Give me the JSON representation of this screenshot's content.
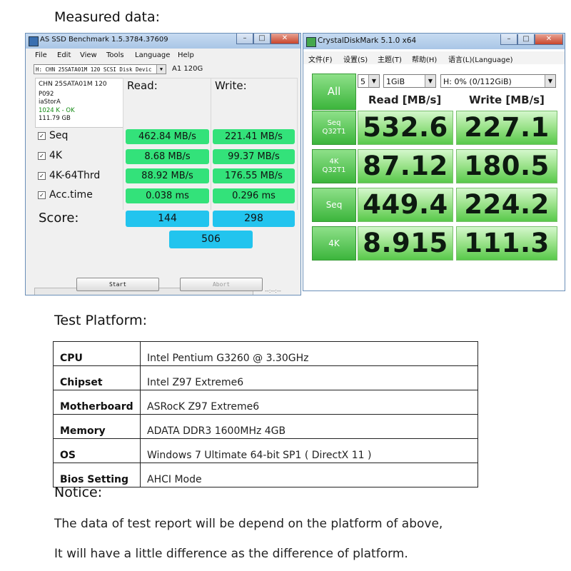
{
  "headings": {
    "measured": "Measured data:",
    "platform": "Test Platform:",
    "notice": "Notice:"
  },
  "asssd": {
    "title": "AS SSD Benchmark 1.5.3784.37609",
    "menu": [
      "File",
      "Edit",
      "View",
      "Tools",
      "Language",
      "Help"
    ],
    "drive_select": "H: CHN 25SATA01M 120 SCSI Disk Devic",
    "drive_name": "A1 120G",
    "info": [
      "CHN 25SATA01M 120",
      "P092",
      "iaStorA",
      "1024 K - OK",
      "111.79 GB"
    ],
    "read_header": "Read:",
    "write_header": "Write:",
    "rows": [
      {
        "label": "Seq",
        "read": "462.84 MB/s",
        "write": "221.41 MB/s"
      },
      {
        "label": "4K",
        "read": "8.68 MB/s",
        "write": "99.37 MB/s"
      },
      {
        "label": "4K-64Thrd",
        "read": "88.92 MB/s",
        "write": "176.55 MB/s"
      },
      {
        "label": "Acc.time",
        "read": "0.038 ms",
        "write": "0.296 ms"
      }
    ],
    "score_label": "Score:",
    "score_read": "144",
    "score_write": "298",
    "score_total": "506",
    "timer": "--:--:--",
    "start": "Start",
    "abort": "Abort",
    "progress_done": 1.0,
    "colors": {
      "green_cell": "#33e27a",
      "blue_cell": "#22c4ee"
    }
  },
  "cdm": {
    "title": "CrystalDiskMark 5.1.0 x64",
    "menu": [
      "文件(F)",
      "设置(S)",
      "主题(T)",
      "帮助(H)",
      "语言(L)(Language)"
    ],
    "all_button": "All",
    "count": "5",
    "size": "1GiB",
    "drive": "H: 0% (0/112GiB)",
    "read_header": "Read [MB/s]",
    "write_header": "Write [MB/s]",
    "rows": [
      {
        "label1": "Seq",
        "label2": "Q32T1",
        "read": "532.6",
        "write": "227.1"
      },
      {
        "label1": "4K",
        "label2": "Q32T1",
        "read": "87.12",
        "write": "180.5"
      },
      {
        "label1": "Seq",
        "label2": "",
        "read": "449.4",
        "write": "224.2"
      },
      {
        "label1": "4K",
        "label2": "",
        "read": "8.915",
        "write": "111.3"
      }
    ]
  },
  "platform": [
    {
      "key": "CPU",
      "value": "Intel Pentium G3260 @ 3.30GHz"
    },
    {
      "key": "Chipset",
      "value": "Intel Z97 Extreme6"
    },
    {
      "key": "Motherboard",
      "value": "ASRocK Z97 Extreme6"
    },
    {
      "key": "Memory",
      "value": "ADATA DDR3 1600MHz 4GB"
    },
    {
      "key": "OS",
      "value": "Windows 7 Ultimate 64-bit SP1 ( DirectX 11 )"
    },
    {
      "key": "Bios Setting",
      "value": "AHCI Mode"
    }
  ],
  "notice_lines": [
    "The data of test report will be depend on the platform of above,",
    "It will have a little difference as the difference of platform."
  ]
}
